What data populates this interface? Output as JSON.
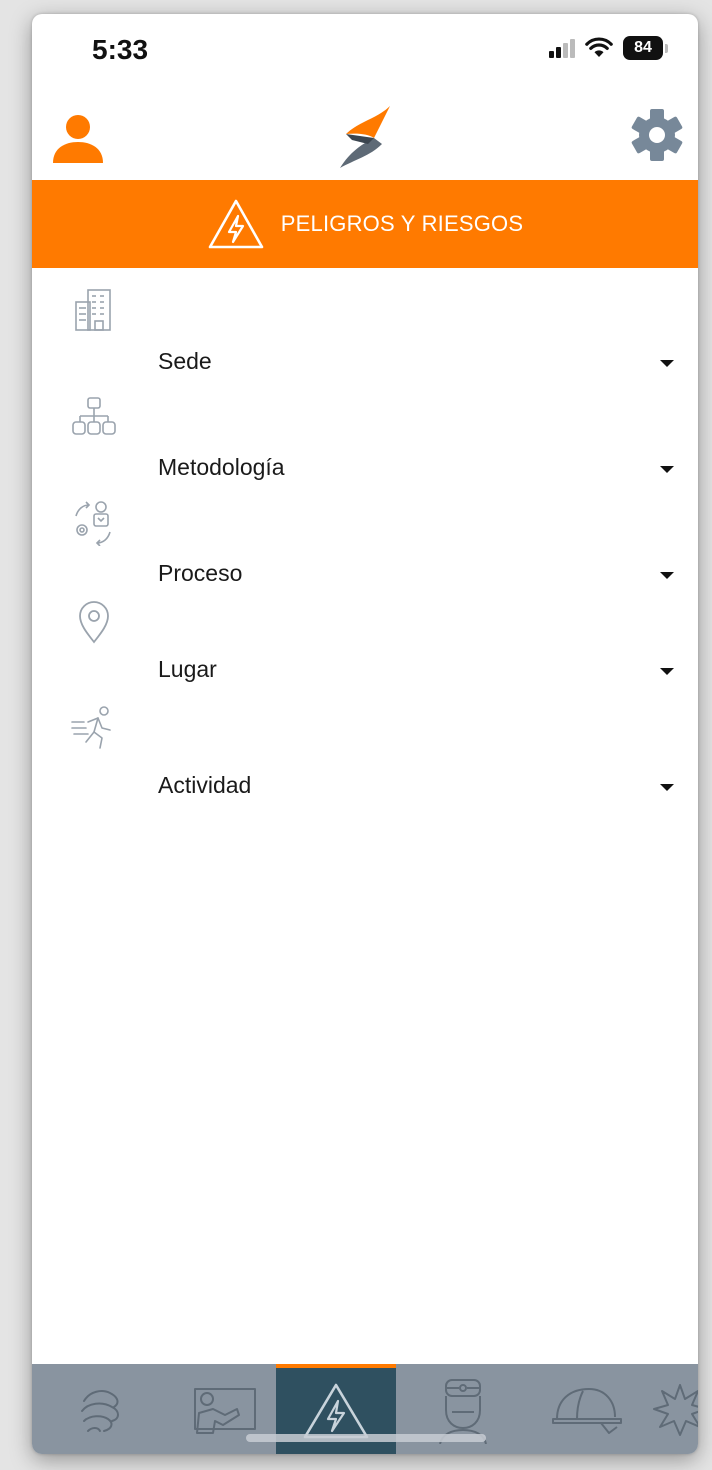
{
  "status_bar": {
    "time": "5:33",
    "battery": "84"
  },
  "header": {
    "user_icon": "user-icon",
    "logo": "app-logo",
    "settings_icon": "gear-icon"
  },
  "banner": {
    "title": "PELIGROS Y RIESGOS",
    "icon": "warning-lightning-icon",
    "color": "#ff7a00"
  },
  "form": {
    "fields": [
      {
        "label": "Sede",
        "icon": "building-icon"
      },
      {
        "label": "Metodología",
        "icon": "org-chart-icon"
      },
      {
        "label": "Proceso",
        "icon": "process-cycle-icon"
      },
      {
        "label": "Lugar",
        "icon": "location-pin-icon"
      },
      {
        "label": "Actividad",
        "icon": "running-person-icon"
      }
    ]
  },
  "bottom_nav": {
    "items": [
      {
        "icon": "brain-icon",
        "active": false
      },
      {
        "icon": "training-board-icon",
        "active": false
      },
      {
        "icon": "warning-lightning-icon",
        "active": true
      },
      {
        "icon": "doctor-icon",
        "active": false
      },
      {
        "icon": "hard-hat-icon",
        "active": false
      },
      {
        "icon": "explosion-icon",
        "active": false
      }
    ],
    "active_color": "#2f5060",
    "accent_color": "#ff7a00"
  }
}
